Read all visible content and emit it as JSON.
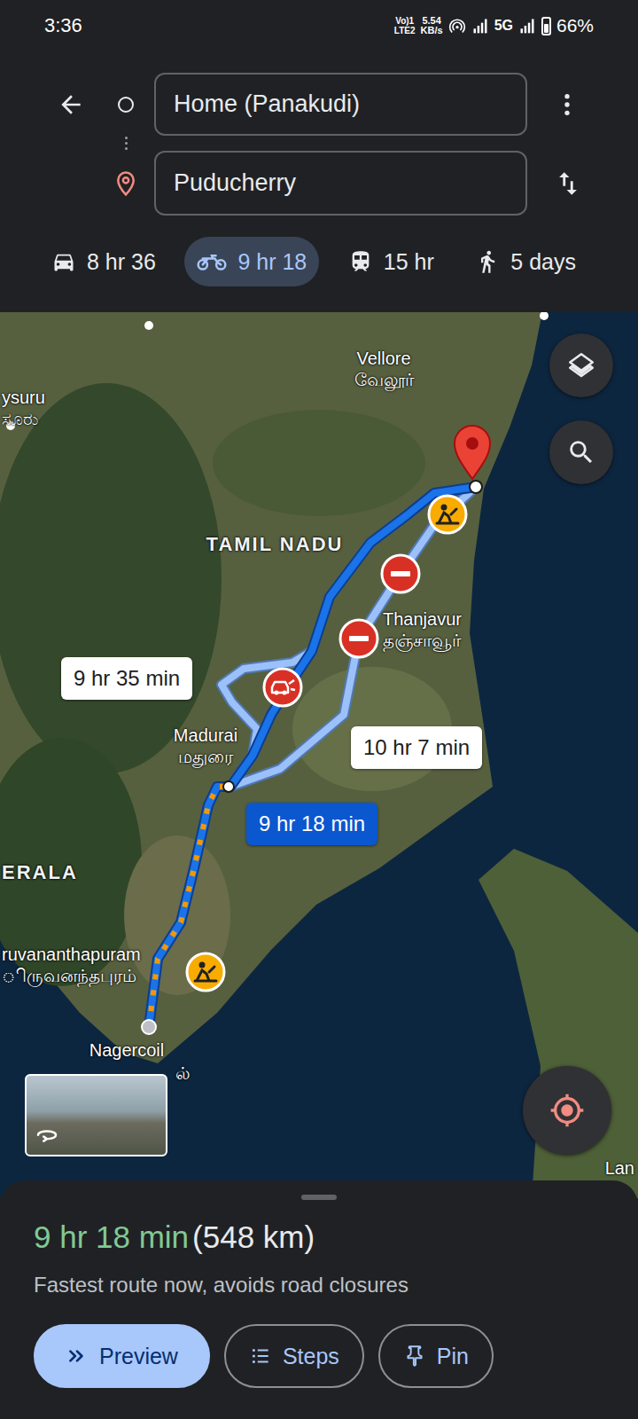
{
  "status_bar": {
    "time": "3:36",
    "volte_top": "Vo)1",
    "volte_bottom": "LTE2",
    "speed_value": "5.54",
    "speed_unit": "KB/s",
    "network": "5G",
    "battery": "66%",
    "battery_level": 0.66
  },
  "search": {
    "origin": "Home (Panakudi)",
    "destination": "Puducherry"
  },
  "modes": [
    {
      "kind": "car",
      "label": "8 hr 36",
      "selected": false
    },
    {
      "kind": "bike",
      "label": "9 hr 18",
      "selected": true
    },
    {
      "kind": "transit",
      "label": "15 hr",
      "selected": false
    },
    {
      "kind": "walk",
      "label": "5 days",
      "selected": false
    }
  ],
  "map": {
    "labels": [
      {
        "text": "ysuru",
        "kind": "city"
      },
      {
        "text": "ಸೂರು",
        "kind": "city"
      },
      {
        "text": "Vellore",
        "kind": "city"
      },
      {
        "text": "வேலூர்",
        "kind": "city"
      },
      {
        "text": "TAMIL NADU",
        "kind": "region"
      },
      {
        "text": "Thanjavur",
        "kind": "city"
      },
      {
        "text": "தஞ்சாவூர்",
        "kind": "city"
      },
      {
        "text": "Madurai",
        "kind": "city"
      },
      {
        "text": "மதுரை",
        "kind": "city"
      },
      {
        "text": "ERALA",
        "kind": "region"
      },
      {
        "text": "ruvananthapuram",
        "kind": "city"
      },
      {
        "text": "ிருவனந்தபுரம்",
        "kind": "city"
      },
      {
        "text": "Nagercoil",
        "kind": "city"
      },
      {
        "text": "ல்",
        "kind": "city"
      },
      {
        "text": "Lan",
        "kind": "city"
      }
    ],
    "routes": [
      {
        "label": "9 hr 35 min",
        "selected": false,
        "traffic": false
      },
      {
        "label": "10 hr 7 min",
        "selected": false,
        "traffic": false
      },
      {
        "label": "9 hr 18 min",
        "selected": true,
        "traffic": true
      }
    ],
    "markers": [
      {
        "kind": "construction"
      },
      {
        "kind": "closure"
      },
      {
        "kind": "closure"
      },
      {
        "kind": "crash"
      },
      {
        "kind": "construction"
      }
    ]
  },
  "summary": {
    "duration": "9 hr 18 min",
    "distance": "(548 km)",
    "note": "Fastest route now, avoids road closures"
  },
  "actions": [
    {
      "kind": "preview",
      "label": "Preview",
      "selected": true
    },
    {
      "kind": "steps",
      "label": "Steps",
      "selected": false
    },
    {
      "kind": "pin",
      "label": "Pin",
      "selected": false
    }
  ]
}
